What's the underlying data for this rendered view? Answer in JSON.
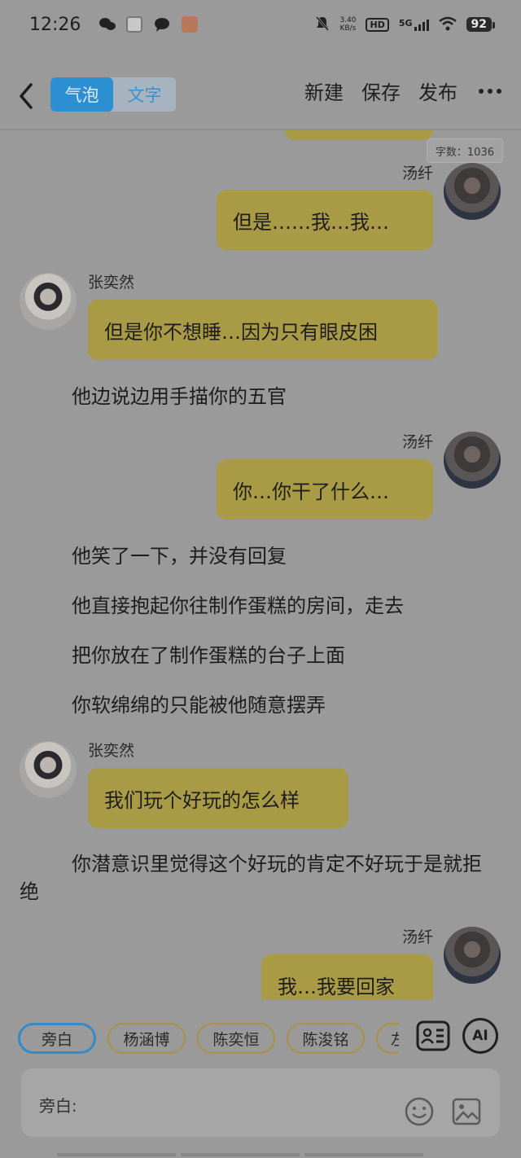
{
  "status_bar": {
    "time": "12:26",
    "net_speed_value": "3.40",
    "net_speed_unit": "KB/s",
    "hd": "HD",
    "network": "5G",
    "battery": "92"
  },
  "header": {
    "mode_tabs": [
      {
        "label": "气泡",
        "active": true
      },
      {
        "label": "文字",
        "active": false
      }
    ],
    "actions": [
      "新建",
      "保存",
      "发布"
    ]
  },
  "word_count": "字数：1036",
  "messages": [
    {
      "type": "bubble",
      "side": "right",
      "speaker": "",
      "text": ""
    },
    {
      "type": "bubble",
      "side": "right",
      "speaker": "汤纤",
      "text": "但是……我…我…"
    },
    {
      "type": "bubble",
      "side": "left",
      "speaker": "张奕然",
      "text": "但是你不想睡…因为只有眼皮困"
    },
    {
      "type": "narration",
      "text": "他边说边用手描你的五官"
    },
    {
      "type": "bubble",
      "side": "right",
      "speaker": "汤纤",
      "text": "你…你干了什么…"
    },
    {
      "type": "narration",
      "text": "他笑了一下，并没有回复"
    },
    {
      "type": "narration",
      "text": "他直接抱起你往制作蛋糕的房间，走去"
    },
    {
      "type": "narration",
      "text": "把你放在了制作蛋糕的台子上面"
    },
    {
      "type": "narration",
      "text": "你软绵绵的只能被他随意摆弄"
    },
    {
      "type": "bubble",
      "side": "left",
      "speaker": "张奕然",
      "text": "我们玩个好玩的怎么样"
    },
    {
      "type": "narration",
      "text": "你潜意识里觉得这个好玩的肯定不好玩于是就拒绝"
    },
    {
      "type": "bubble",
      "side": "right",
      "speaker": "汤纤",
      "text": "我…我要回家"
    }
  ],
  "roles": [
    {
      "label": "旁白",
      "active": true
    },
    {
      "label": "杨涵博",
      "active": false
    },
    {
      "label": "陈奕恒",
      "active": false
    },
    {
      "label": "陈浚铭",
      "active": false
    },
    {
      "label": "左奇",
      "active": false
    }
  ],
  "input": {
    "label": "旁白:",
    "value": ""
  },
  "ai_label": "AI",
  "colors": {
    "background": "#9a9a9a",
    "bubble": "#a99a45",
    "accent": "#2b8fd2"
  }
}
